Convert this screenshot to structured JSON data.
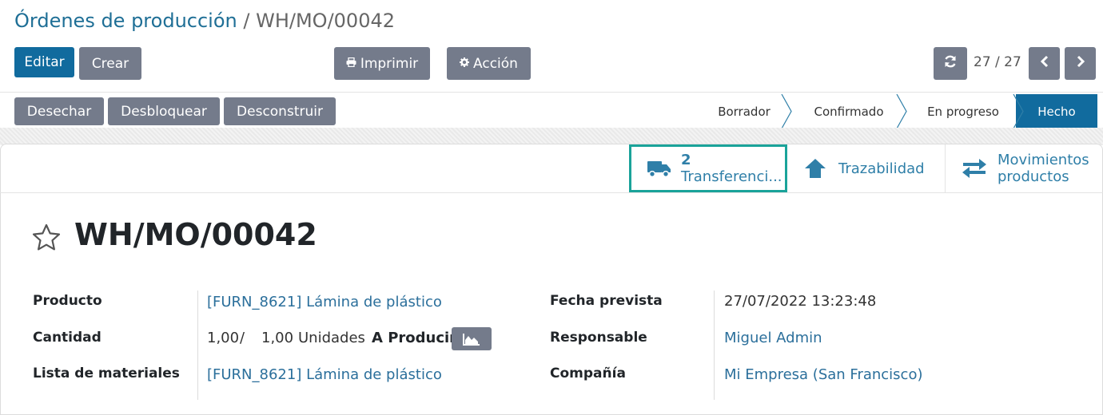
{
  "breadcrumb": {
    "parent": "Órdenes de producción",
    "separator": "/",
    "current": "WH/MO/00042"
  },
  "toolbar": {
    "edit": "Editar",
    "create": "Crear",
    "print": "Imprimir",
    "action": "Acción"
  },
  "pager": {
    "value": "27 / 27"
  },
  "status_actions": {
    "scrap": "Desechar",
    "unlock": "Desbloquear",
    "unbuild": "Desconstruir"
  },
  "stages": [
    {
      "label": "Borrador",
      "state": "inactive"
    },
    {
      "label": "Confirmado",
      "state": "inactive"
    },
    {
      "label": "En progreso",
      "state": "inactive"
    },
    {
      "label": "Hecho",
      "state": "active"
    }
  ],
  "smart_buttons": {
    "transfers": {
      "count": "2",
      "label": "Transferenci..."
    },
    "traceability": {
      "label": "Trazabilidad"
    },
    "moves": {
      "line1": "Movimientos",
      "line2": "productos"
    }
  },
  "record": {
    "name": "WH/MO/00042",
    "fields_left": {
      "product_label": "Producto",
      "product_value": "[FURN_8621] Lámina de plástico",
      "qty_label": "Cantidad",
      "qty_done": "1,00",
      "qty_sep": "/",
      "qty_total": "1,00",
      "uom": "Unidades",
      "to_produce": "A Producir",
      "bom_label": "Lista de materiales",
      "bom_value": "[FURN_8621] Lámina de plástico"
    },
    "fields_right": {
      "date_label": "Fecha prevista",
      "date_value": "27/07/2022 13:23:48",
      "responsible_label": "Responsable",
      "responsible_value": "Miguel Admin",
      "company_label": "Compañía",
      "company_value": "Mi Empresa (San Francisco)"
    }
  },
  "colors": {
    "primary": "#116b9e",
    "secondary": "#747b8b",
    "link": "#2b6f9b",
    "highlight": "#1aa39a"
  }
}
